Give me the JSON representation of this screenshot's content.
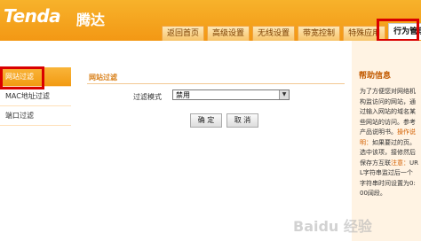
{
  "brand": {
    "logo": "Tenda",
    "logo_cn": "腾达"
  },
  "tabs": [
    {
      "label": "返回首页"
    },
    {
      "label": "高级设置"
    },
    {
      "label": "无线设置"
    },
    {
      "label": "带宽控制"
    },
    {
      "label": "特殊应用"
    },
    {
      "label": "行为管理"
    }
  ],
  "active_tab": "行为管理",
  "sidebar": {
    "items": [
      {
        "label": "网站过滤"
      },
      {
        "label": "MAC地址过滤"
      },
      {
        "label": "端口过滤"
      }
    ]
  },
  "main": {
    "panel_title": "网站过滤",
    "filter_mode_label": "过滤模式",
    "filter_mode_value": "禁用",
    "ok_label": "确 定",
    "cancel_label": "取 消"
  },
  "help": {
    "title": "帮助信息",
    "p1": "为了方便您对网络机构监访问的网站，通过输入网站的域名某些网站的访问。参考产品说明书。",
    "op_label": "操作说明：",
    "p2": "如果要过的页。选中该项，接修然后保存方互联",
    "note_label": "注意：",
    "p3": "URL字符串监过后一个字符串时间设置为0:00阔段。"
  },
  "watermark": "Baidu 经验",
  "colors": {
    "header": "#f39814",
    "highlight": "#d90000",
    "accent": "#d9801a"
  }
}
